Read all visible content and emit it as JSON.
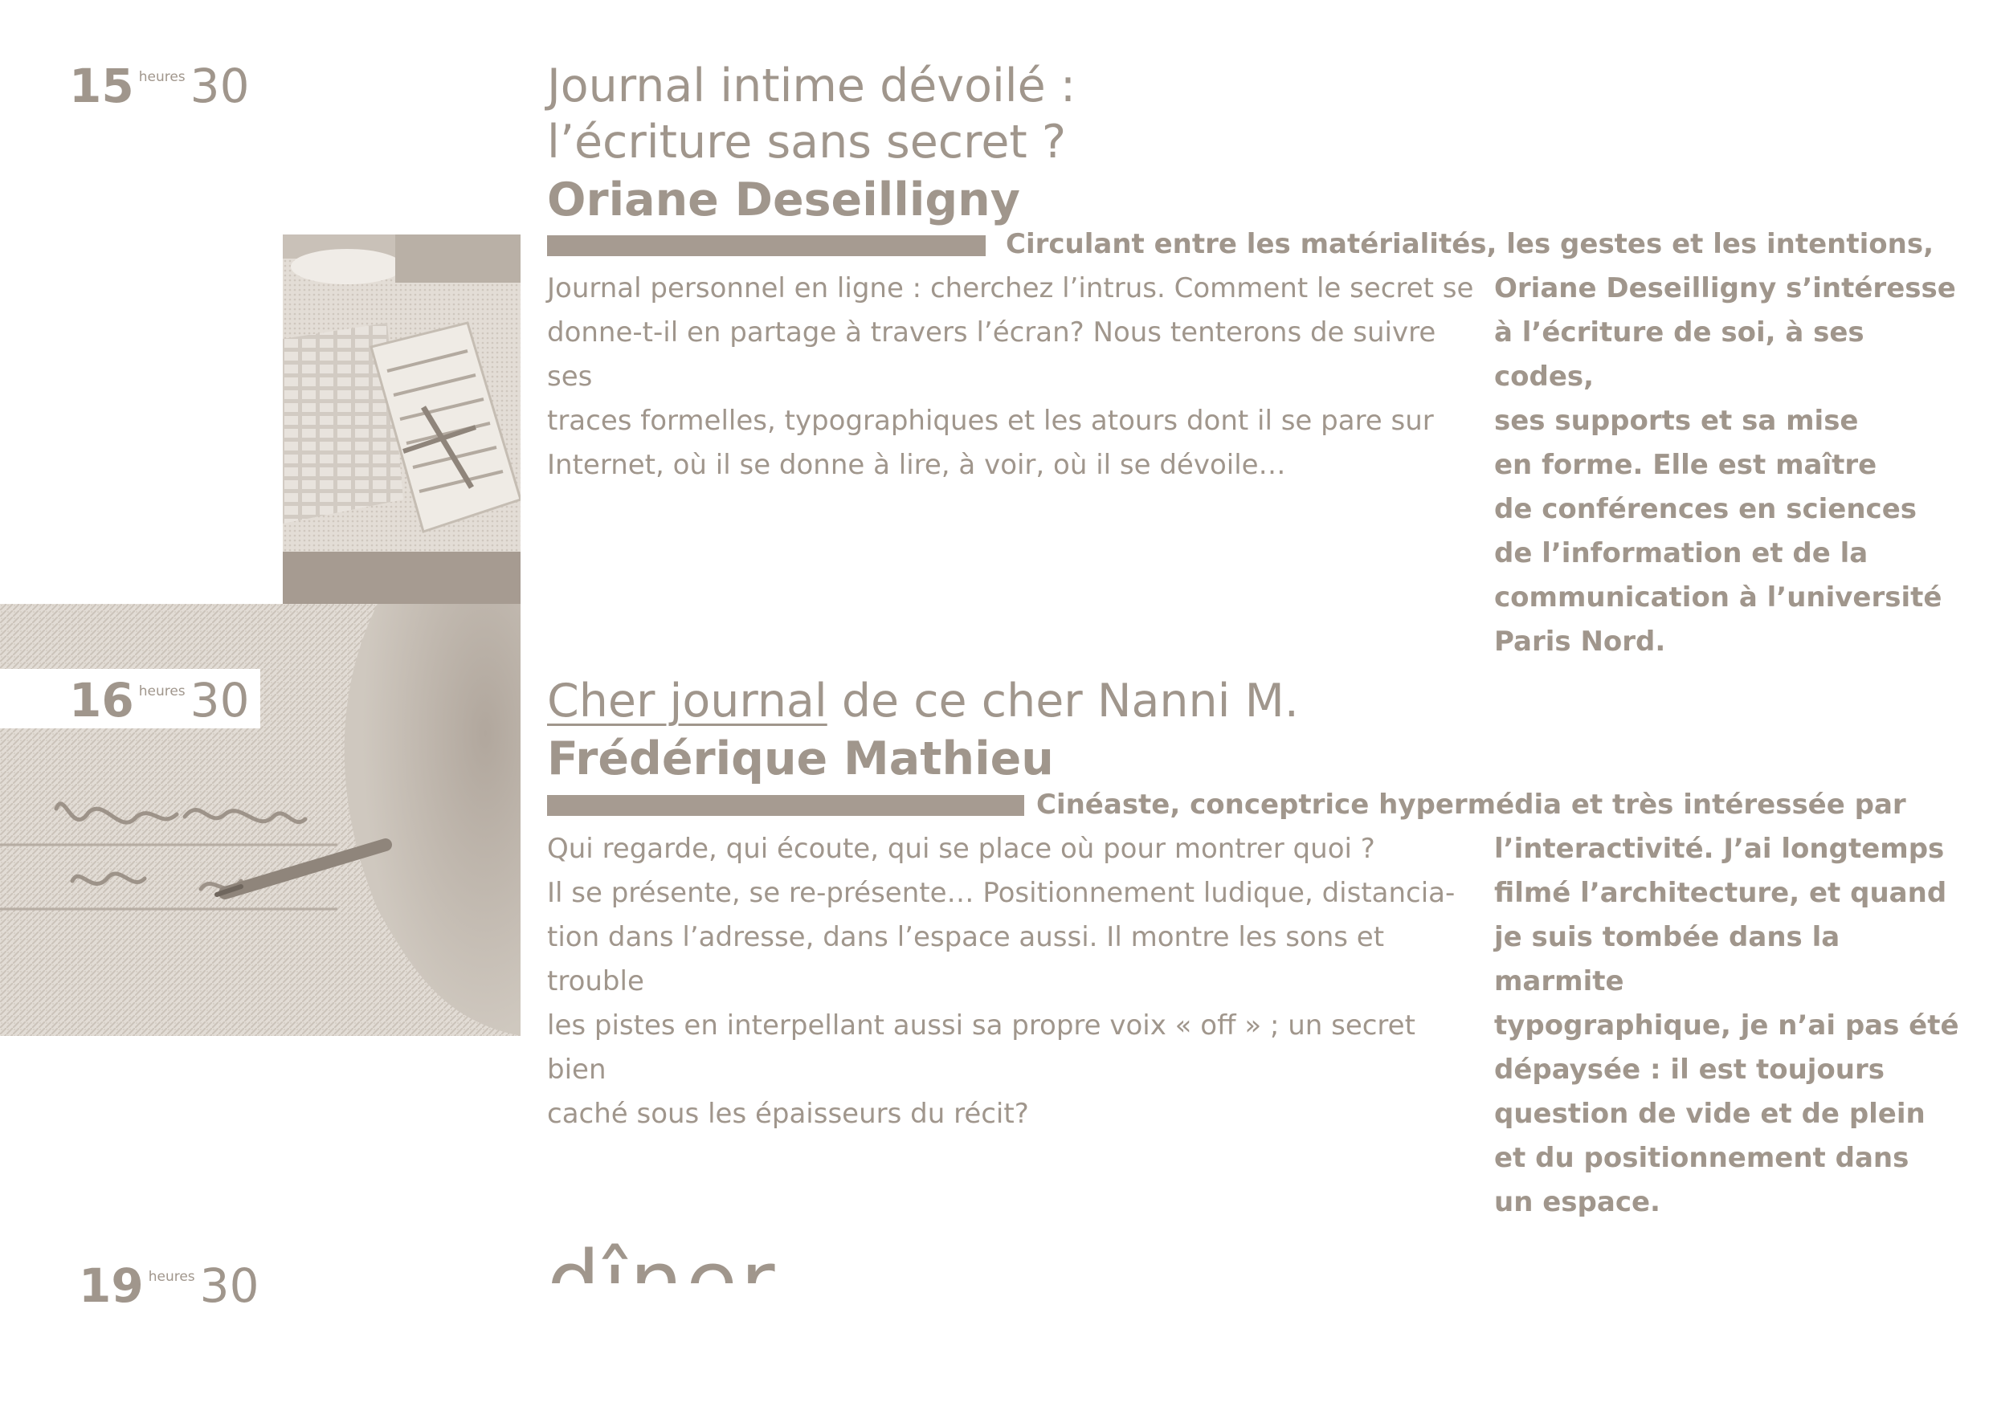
{
  "time_word": "heures",
  "sessions": [
    {
      "hour": "15",
      "minutes": "30",
      "title_lines": [
        "Journal intime dévoilé :",
        "l’écriture sans secret ?"
      ],
      "speaker": "Oriane Deseilligny",
      "intro_bold": "Circulant entre les matérialités, les gestes et les intentions,",
      "body": "Journal personnel en ligne : cherchez l’intrus. Comment le secret se\ndonne-t-il en partage à travers l’écran? Nous tenterons de suivre ses\ntraces formelles, typographiques et les atours dont il se pare sur\nInternet, où il se donne à lire, à voir, où il se dévoile…",
      "bio": "Oriane Deseilligny s’intéresse\nà l’écriture de soi, à ses codes,\nses supports et sa mise\nen forme. Elle est maître\nde conférences en sciences\nde l’information et de la\ncommunication à l’université\nParis Nord.",
      "photo": "typewriter-notebook-photo"
    },
    {
      "hour": "16",
      "minutes": "30",
      "title_underlined": "Cher journal",
      "title_rest": " de ce cher Nanni M.",
      "speaker": "Frédérique Mathieu",
      "intro_bold": "Cinéaste, conceptrice hypermédia et très intéressée par",
      "body": "Qui regarde, qui écoute, qui se place où pour montrer quoi ?\nIl se présente, se re-présente… Positionnement ludique, distancia-\ntion dans l’adresse, dans l’espace aussi. Il montre les sons et trouble\nles pistes en interpellant aussi sa propre voix « off » ; un secret bien\ncaché sous les épaisseurs du récit?",
      "bio": "l’interactivité. J’ai longtemps\nfilmé l’architecture, et quand\nje suis tombée dans la marmite\ntypographique, je n’ai pas été\ndépaysée : il est toujours\nquestion de vide et de plein\net du positionnement dans\nun espace.",
      "photo": "handwriting-pen-photo"
    },
    {
      "hour": "19",
      "minutes": "30",
      "title": "dîner"
    }
  ],
  "colors": {
    "text": "#a0968c",
    "rule": "#a69b91",
    "photo_tint": "#d9d2ca"
  }
}
